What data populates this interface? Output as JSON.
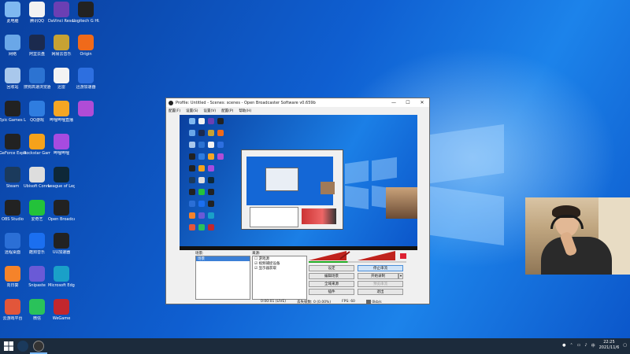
{
  "desktop": {
    "icons": [
      {
        "label": "此电脑",
        "color": "#7fb8f0"
      },
      {
        "label": "腾讯QQ",
        "color": "#f2f2f2"
      },
      {
        "label": "DaVinci Resolve",
        "color": "#6b3fb3"
      },
      {
        "label": "Logitech G HUB",
        "color": "#222"
      },
      {
        "label": "网络",
        "color": "#6aa7e8"
      },
      {
        "label": "阿里云盘",
        "color": "#1b2a4e"
      },
      {
        "label": "网易云音乐",
        "color": "#c7a233"
      },
      {
        "label": "Origin",
        "color": "#f06a1a"
      },
      {
        "label": "回收站",
        "color": "#a9c8ec"
      },
      {
        "label": "搜狗高速浏览器",
        "color": "#2c73d2"
      },
      {
        "label": "迅雷",
        "color": "#f3f3f3"
      },
      {
        "label": "迅游加速器",
        "color": "#2d6fe0"
      },
      {
        "label": "Epic Games Launcher",
        "color": "#222"
      },
      {
        "label": "QQ游戏",
        "color": "#2f7de0"
      },
      {
        "label": "哔哩哔哩直播",
        "color": "#f6a623"
      },
      {
        "label": "",
        "color": "#b04cd6"
      },
      {
        "label": "GeForce Experience",
        "color": "#222"
      },
      {
        "label": "Rockstar Games Launcher",
        "color": "#f5a21b"
      },
      {
        "label": "哔哩哔哩",
        "color": "#a64be0"
      },
      {
        "label": "",
        "color": "#0000"
      },
      {
        "label": "Steam",
        "color": "#1b3a5c"
      },
      {
        "label": "Ubisoft Connect",
        "color": "#ddd"
      },
      {
        "label": "League of Legends",
        "color": "#0e2838"
      },
      {
        "label": "",
        "color": "#0000"
      },
      {
        "label": "OBS Studio",
        "color": "#222"
      },
      {
        "label": "爱奇艺",
        "color": "#23c23a"
      },
      {
        "label": "Open Broadcaster",
        "color": "#222"
      },
      {
        "label": "",
        "color": "#0000"
      },
      {
        "label": "远程桌面",
        "color": "#2b6fd6"
      },
      {
        "label": "酷狗音乐",
        "color": "#1b6ff0"
      },
      {
        "label": "UU加速器",
        "color": "#222"
      },
      {
        "label": "",
        "color": "#0000"
      },
      {
        "label": "向日葵",
        "color": "#f5832a"
      },
      {
        "label": "Snipaste",
        "color": "#6a5ad6"
      },
      {
        "label": "Microsoft Edge",
        "color": "#1aa0c8"
      },
      {
        "label": "",
        "color": "#0000"
      },
      {
        "label": "云游戏平台",
        "color": "#e2563a"
      },
      {
        "label": "微信",
        "color": "#2ac25a"
      },
      {
        "label": "WeGame",
        "color": "#c2272d"
      }
    ]
  },
  "obs": {
    "title": "Profile: Untitled - Scenes: scenes - Open Broadcaster Software v0.659b",
    "menu": [
      "配置(F)",
      "设置(S)",
      "设置(V)",
      "配置(P)",
      "帮助(H)"
    ],
    "scenes_label": "场景:",
    "scenes": [
      "场景"
    ],
    "sources_label": "来源:",
    "sources": [
      "游戏源",
      "视频捕捉设备",
      "显示器获取"
    ],
    "buttons": {
      "settings": "设定",
      "stop_stream": "停止串流",
      "edit_scene": "编辑场景",
      "start_record": "开始录制",
      "global_sources": "全域来源",
      "preview": "预览串流",
      "plugins": "插件",
      "exit": "退出"
    },
    "status": {
      "time": "0:00:01 (LIVE)",
      "dropped": "丢失帧数: 0 (0.00%)",
      "fps": "FPS: 60",
      "bitrate": "0kb/s"
    }
  },
  "taskbar": {
    "time": "22:25",
    "date": "2021/11/6"
  },
  "colors": {
    "accent": "#0f5fd1",
    "taskbar": "#1c2b3c"
  }
}
